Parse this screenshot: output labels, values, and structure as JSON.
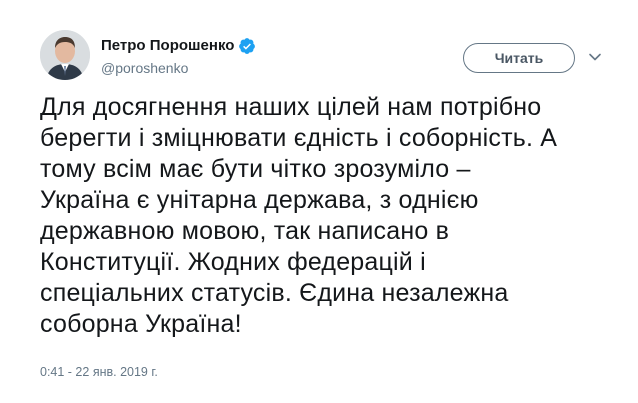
{
  "author": {
    "display_name": "Петро Порошенко",
    "handle": "@poroshenko",
    "verified": true
  },
  "actions": {
    "follow_label": "Читать"
  },
  "tweet": {
    "text": "Для досягнення наших цілей нам потрібно\nберегти і зміцнювати єдність і соборність. А\nтому всім має бути чітко зрозуміло –\nУкраїна є унітарна держава, з однією\nдержавною мовою, так написано в\nКонституції. Жодних федерацій і\nспеціальних статусів. Єдина незалежна\nсоборна Україна!",
    "timestamp": "0:41 - 22 янв. 2019 г."
  },
  "icons": {
    "verified": "verified-badge-icon",
    "caret": "chevron-down-icon"
  },
  "colors": {
    "verified_blue": "#1da1f2",
    "secondary_text": "#657786",
    "primary_text": "#14171a"
  }
}
